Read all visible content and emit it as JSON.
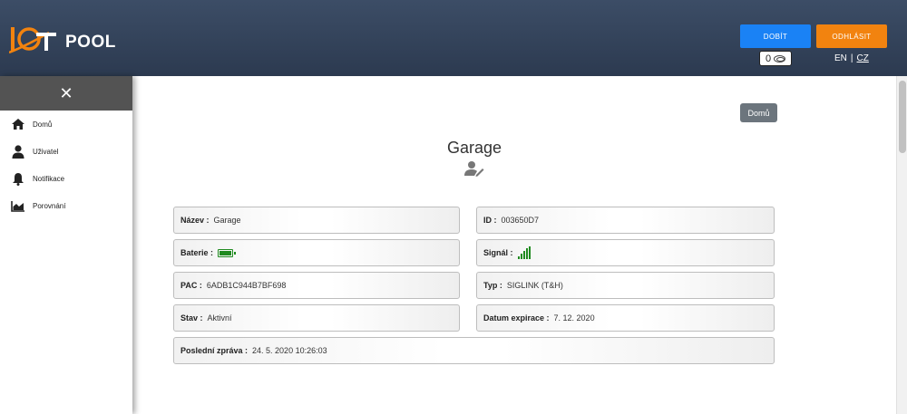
{
  "header": {
    "logo_text": "IOTPOOL",
    "logo_pool": "POOL",
    "dobit_label": "DOBÍT",
    "odhlasit_label": "ODHLÁSIT",
    "credit_value": "0",
    "lang_en": "EN",
    "lang_sep": "|",
    "lang_cz": "CZ"
  },
  "sidebar": {
    "items": [
      {
        "label": "Domů",
        "icon": "home-icon"
      },
      {
        "label": "Uživatel",
        "icon": "user-icon"
      },
      {
        "label": "Notifikace",
        "icon": "bell-icon"
      },
      {
        "label": "Porovnání",
        "icon": "area-chart-icon"
      }
    ]
  },
  "main": {
    "home_button": "Domů",
    "title": "Garage",
    "fields": {
      "name": {
        "label": "Název :",
        "value": "Garage"
      },
      "id": {
        "label": "ID :",
        "value": "003650D7"
      },
      "battery": {
        "label": "Baterie :"
      },
      "signal": {
        "label": "Signál :"
      },
      "pac": {
        "label": "PAC :",
        "value": "6ADB1C944B7BF698"
      },
      "type": {
        "label": "Typ :",
        "value": "SIGLINK (T&H)"
      },
      "state": {
        "label": "Stav :",
        "value": "Aktivní"
      },
      "expiry": {
        "label": "Datum expirace :",
        "value": "7. 12. 2020"
      },
      "last_message": {
        "label": "Poslední zpráva :",
        "value": "24. 5. 2020 10:26:03"
      }
    }
  },
  "colors": {
    "header_bg": "#34445b",
    "dobit": "#1a82f5",
    "odhlasit": "#f2830f",
    "logo_orange": "#f2830f",
    "status_green": "#1f8a1f"
  }
}
